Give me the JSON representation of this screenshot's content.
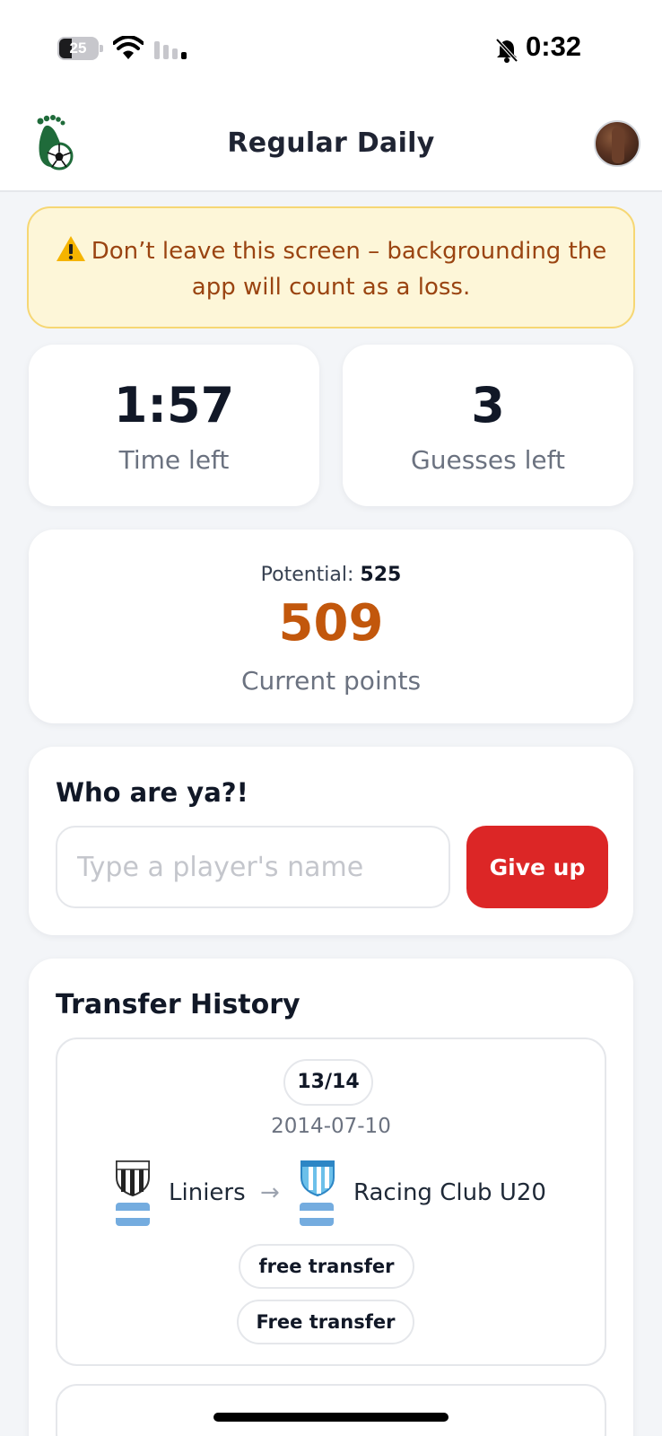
{
  "status_bar": {
    "battery_level": "25",
    "time": "0:32",
    "icons": [
      "battery-icon",
      "wifi-icon",
      "cellular-signal-icon",
      "silent-bell-icon"
    ]
  },
  "header": {
    "title": "Regular Daily",
    "logo_icon": "footprint-soccer-ball-logo",
    "avatar_icon": "user-avatar"
  },
  "warning": {
    "icon": "warning-icon",
    "text": "Don’t leave this screen – backgrounding the app will count as a loss."
  },
  "stats": {
    "time_value": "1:57",
    "time_label": "Time left",
    "guesses_value": "3",
    "guesses_label": "Guesses left"
  },
  "points": {
    "potential_label": "Potential:",
    "potential_value": "525",
    "current_value": "509",
    "current_label": "Current points"
  },
  "guess": {
    "title": "Who are ya?!",
    "placeholder": "Type a player's name",
    "value": "",
    "give_up_label": "Give up"
  },
  "transfer_history": {
    "title": "Transfer History",
    "items": [
      {
        "index": "13/14",
        "date": "2014-07-10",
        "from_club": "Liniers",
        "to_club": "Racing Club U20",
        "from_flag": "argentina-flag",
        "to_flag": "argentina-flag",
        "fee_pills": [
          "free transfer",
          "Free transfer"
        ]
      }
    ]
  },
  "colors": {
    "accent_orange": "#c2570c",
    "give_up_red": "#dc2626",
    "warning_bg": "#fdf6d8",
    "warning_border": "#f6d774",
    "warning_text": "#9a4411",
    "logo_green": "#1f6b3a"
  }
}
